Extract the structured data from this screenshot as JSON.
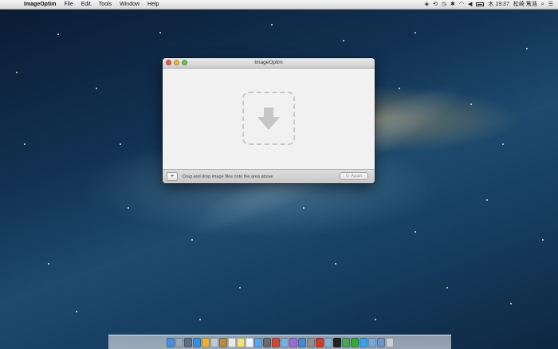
{
  "menubar": {
    "apple": "",
    "items": [
      "ImageOptim",
      "File",
      "Edit",
      "Tools",
      "Window",
      "Help"
    ],
    "clock": "木 19:37",
    "user": "松崎 篤浩"
  },
  "window": {
    "title": "ImageOptim",
    "footer_text": "Drag and drop image files onto the area above",
    "add_label": "+",
    "again_label": "Again",
    "again_icon": "↻"
  },
  "dock": {
    "items": [
      {
        "icon": "finder-icon",
        "color": "#4a8fd8"
      },
      {
        "icon": "launchpad-icon",
        "color": "#9aa7b5"
      },
      {
        "icon": "mission-control-icon",
        "color": "#5d6e86"
      },
      {
        "icon": "safari-icon",
        "color": "#3c8fd6"
      },
      {
        "icon": "chrome-icon",
        "color": "#e3b23c"
      },
      {
        "icon": "mail-icon",
        "color": "#bfc8d4"
      },
      {
        "icon": "contacts-icon",
        "color": "#b38a4a"
      },
      {
        "icon": "calendar-icon",
        "color": "#e8e8e8"
      },
      {
        "icon": "notes-icon",
        "color": "#f0e27a"
      },
      {
        "icon": "reminders-icon",
        "color": "#f4f4f4"
      },
      {
        "icon": "messages-icon",
        "color": "#5fa3e3"
      },
      {
        "icon": "facetime-icon",
        "color": "#6a6a6a"
      },
      {
        "icon": "photo-booth-icon",
        "color": "#c94b3c"
      },
      {
        "icon": "iphoto-icon",
        "color": "#7ab0d6"
      },
      {
        "icon": "itunes-icon",
        "color": "#9c6bcf"
      },
      {
        "icon": "app-store-icon",
        "color": "#4d86c9"
      },
      {
        "icon": "system-preferences-icon",
        "color": "#8f8f8f"
      },
      {
        "icon": "acrobat-icon",
        "color": "#d13b2e"
      },
      {
        "icon": "preview-icon",
        "color": "#8ab0cf"
      },
      {
        "icon": "terminal-icon",
        "color": "#222222"
      },
      {
        "icon": "activity-monitor-icon",
        "color": "#4aa35a"
      },
      {
        "icon": "evernote-icon",
        "color": "#3da33e"
      },
      {
        "icon": "twitter-icon",
        "color": "#3fa0e0"
      },
      {
        "icon": "folder-icon",
        "color": "#7aa8d8"
      },
      {
        "icon": "downloads-icon",
        "color": "#6f95c5"
      },
      {
        "icon": "trash-icon",
        "color": "#c9ced6"
      }
    ]
  }
}
